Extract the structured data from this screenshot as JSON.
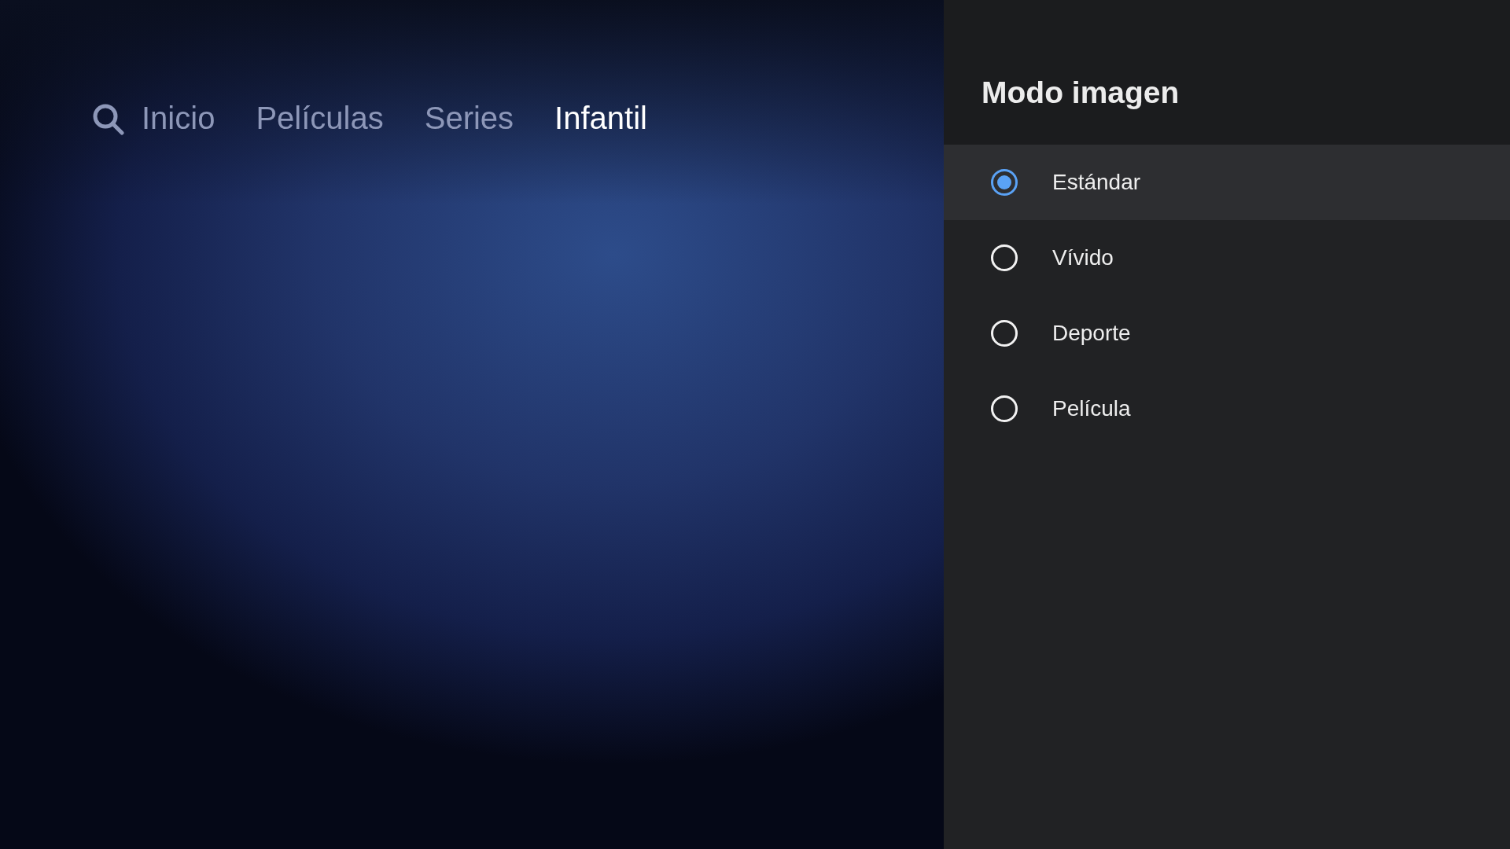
{
  "nav": {
    "tabs": [
      {
        "label": "Inicio",
        "selected": false
      },
      {
        "label": "Películas",
        "selected": false
      },
      {
        "label": "Series",
        "selected": false
      },
      {
        "label": "Infantil",
        "selected": true
      }
    ]
  },
  "panel": {
    "title": "Modo imagen",
    "options": [
      {
        "label": "Estándar",
        "selected": true
      },
      {
        "label": "Vívido",
        "selected": false
      },
      {
        "label": "Deporte",
        "selected": false
      },
      {
        "label": "Película",
        "selected": false
      }
    ]
  }
}
